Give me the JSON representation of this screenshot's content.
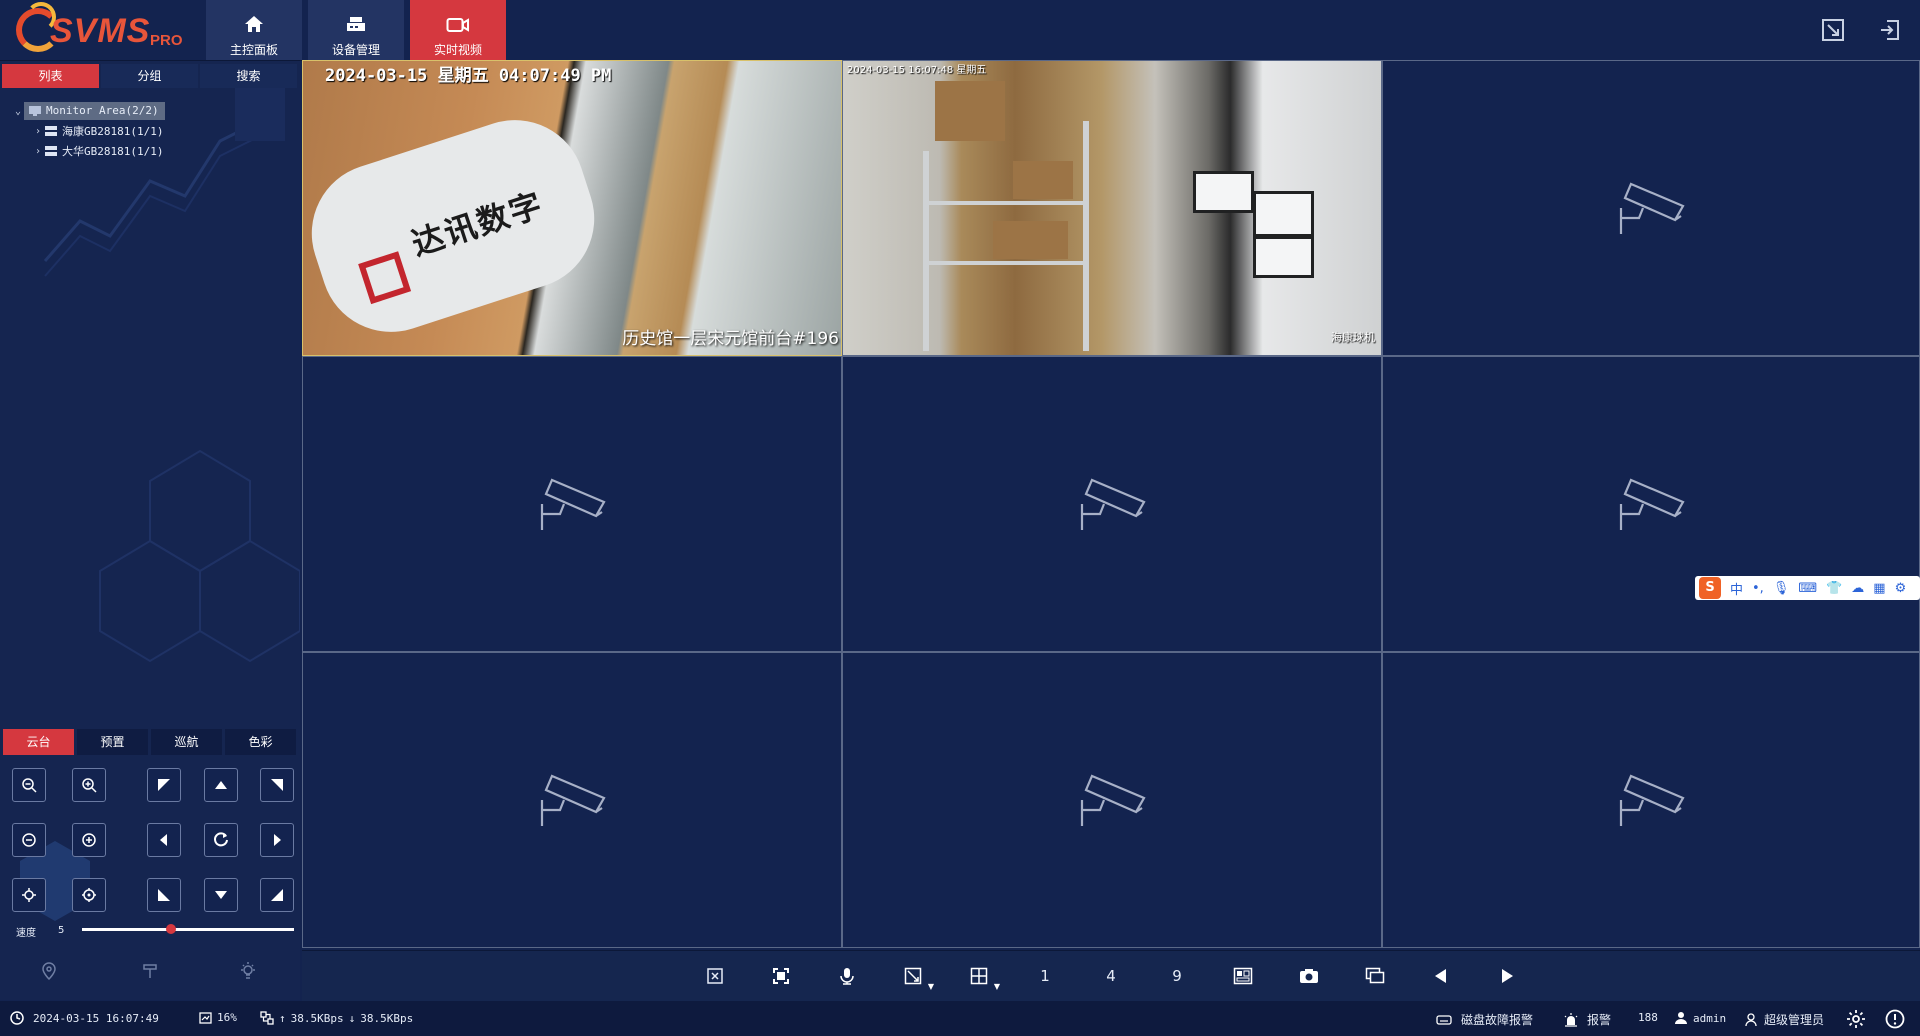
{
  "app": {
    "name": "SVMS",
    "edition": "PRO"
  },
  "colors": {
    "accent": "#d5383f",
    "background": "#13234f",
    "panel": "#152550",
    "selected_border": "#d8c16a"
  },
  "nav": {
    "tabs": [
      {
        "label": "主控面板",
        "icon": "home-icon",
        "active": false
      },
      {
        "label": "设备管理",
        "icon": "device-icon",
        "active": false
      },
      {
        "label": "实时视频",
        "icon": "video-camera-icon",
        "active": true
      }
    ]
  },
  "sidebar": {
    "tabs": [
      {
        "label": "列表",
        "active": true
      },
      {
        "label": "分组",
        "active": false
      },
      {
        "label": "搜索",
        "active": false
      }
    ],
    "tree": {
      "root": "Monitor Area(2/2)",
      "children": [
        "海康GB28181(1/1)",
        "大华GB28181(1/1)"
      ]
    }
  },
  "ptz": {
    "tabs": [
      {
        "label": "云台",
        "active": true
      },
      {
        "label": "预置",
        "active": false
      },
      {
        "label": "巡航",
        "active": false
      },
      {
        "label": "色彩",
        "active": false
      }
    ],
    "speed_label": "速度",
    "speed_value": "5",
    "speed_fraction": 0.42
  },
  "video": {
    "layout": "3x3",
    "cells": [
      {
        "feed": true,
        "selected": true,
        "osd_top": "2024-03-15  星期五  04:07:49 PM",
        "osd_bottom": "历史馆一层宋元馆前台#196",
        "sign_text": "达讯数字"
      },
      {
        "feed": true,
        "selected": false,
        "osd_top": "2024-03-15 16:07:48 星期五",
        "osd_bottom": "海康球机"
      },
      {
        "feed": false
      },
      {
        "feed": false
      },
      {
        "feed": false
      },
      {
        "feed": false
      },
      {
        "feed": false
      },
      {
        "feed": false
      },
      {
        "feed": false
      }
    ]
  },
  "ime": {
    "logo": "S",
    "mode": "中"
  },
  "toolbar": {
    "layout_1": "1",
    "layout_4": "4",
    "layout_9": "9"
  },
  "status": {
    "datetime": "2024-03-15 16:07:49",
    "cpu": "16%",
    "upload": "38.5KBps",
    "download": "38.5KBps",
    "disk_alarm": "磁盘故障报警",
    "alarm": "报警",
    "alarm_count": "188",
    "user": "admin",
    "role": "超级管理员"
  }
}
